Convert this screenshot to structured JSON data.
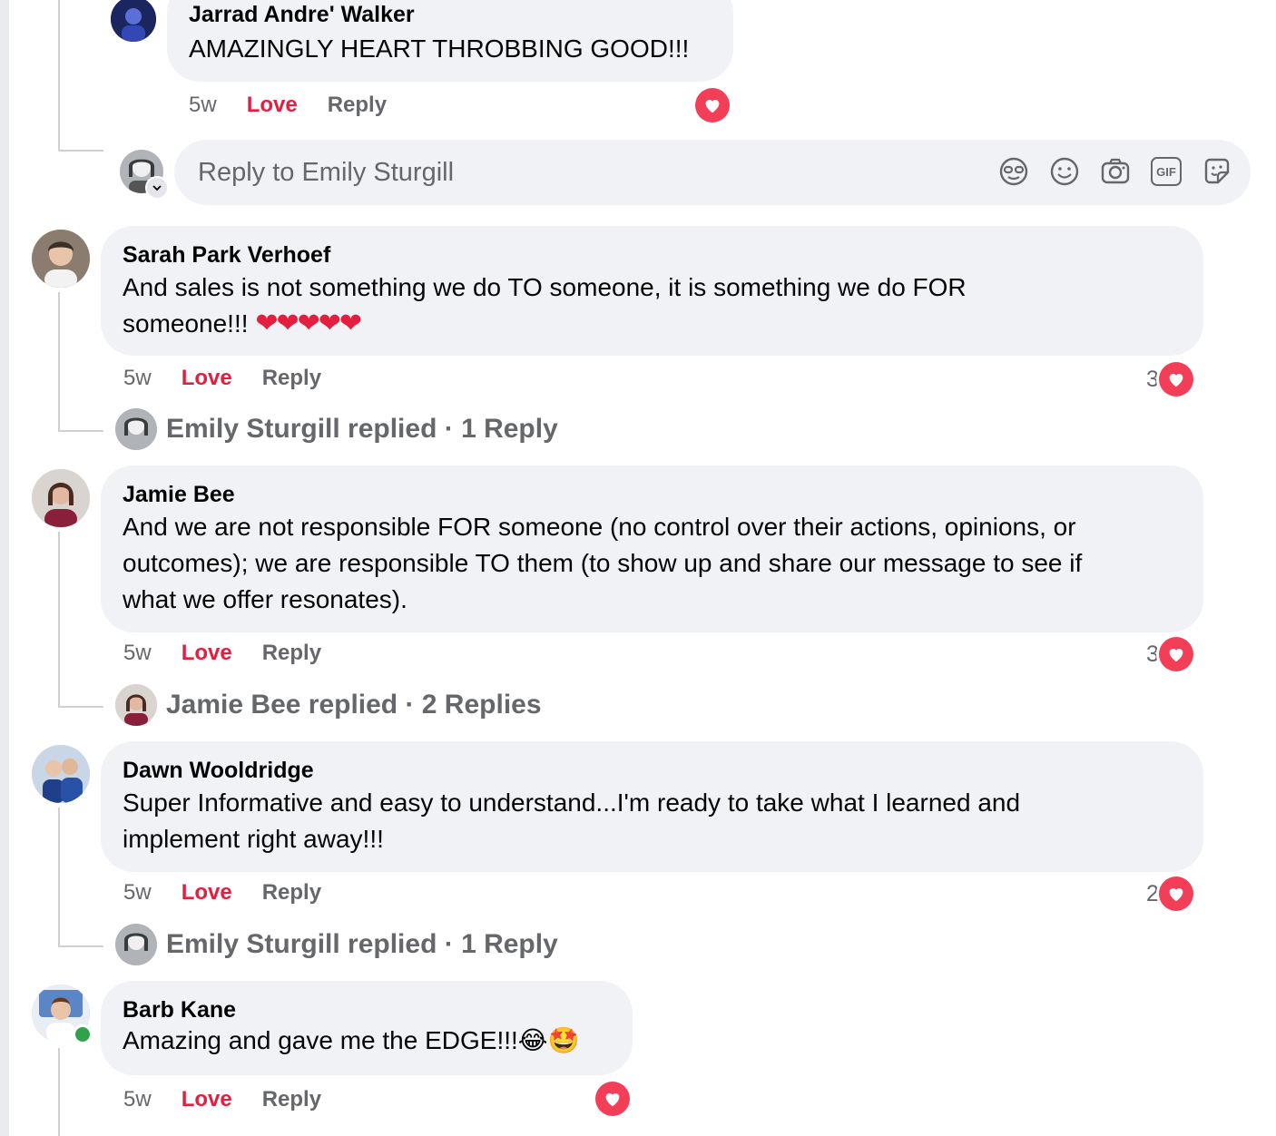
{
  "top_comment": {
    "author": "Jarrad Andre' Walker",
    "text": "AMAZINGLY HEART THROBBING GOOD!!!",
    "time": "5w",
    "love": "Love",
    "reply": "Reply"
  },
  "reply_box": {
    "placeholder": "Reply to Emily Sturgill",
    "icons": [
      "avatar-sticker-icon",
      "emoji-icon",
      "camera-icon",
      "gif-icon",
      "sticker-icon"
    ],
    "gif_label": "GIF"
  },
  "comments": [
    {
      "author": "Sarah Park Verhoef",
      "text_line1": "And sales is not something we do TO someone, it is something we do FOR",
      "text_line2": "someone!!!",
      "hearts": "❤❤❤❤❤",
      "time": "5w",
      "love": "Love",
      "reply": "Reply",
      "reaction_count": "3",
      "replied": "Emily Sturgill replied · 1 Reply"
    },
    {
      "author": "Jamie Bee",
      "text_line1": "And we are not responsible FOR someone (no control over their actions, opinions, or",
      "text_line2": "outcomes); we are responsible TO them (to show up and share our message to see if",
      "text_line3": "what we offer resonates).",
      "time": "5w",
      "love": "Love",
      "reply": "Reply",
      "reaction_count": "3",
      "replied": "Jamie Bee replied · 2 Replies"
    },
    {
      "author": "Dawn Wooldridge",
      "text_line1": "Super Informative and easy to understand...I'm ready to take what I learned and",
      "text_line2": "implement right away!!!",
      "time": "5w",
      "love": "Love",
      "reply": "Reply",
      "reaction_count": "2",
      "replied": "Emily Sturgill replied · 1 Reply"
    },
    {
      "author": "Barb Kane",
      "text_line1": "Amazing and gave me the EDGE!!!",
      "emoji": "😂🤩",
      "time": "5w",
      "love": "Love",
      "reply": "Reply"
    }
  ],
  "colors": {
    "bubble": "#f0f2f5",
    "love": "#e41e3f",
    "heart": "#f33e58",
    "secondary_text": "#65676b",
    "online": "#31a24c"
  }
}
